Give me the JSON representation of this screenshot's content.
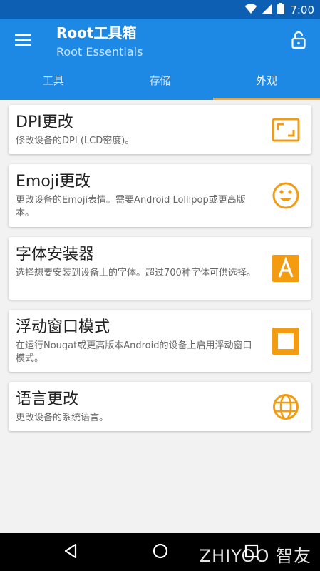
{
  "status_bar": {
    "time": "7:00"
  },
  "app_bar": {
    "title": "Root工具箱",
    "subtitle": "Root Essentials",
    "colors": {
      "primary": "#1e88e5",
      "status": "#0d5fb3",
      "accent": "#f5a623"
    }
  },
  "tabs": [
    {
      "label": "工具"
    },
    {
      "label": "存储"
    },
    {
      "label": "外观",
      "active": true
    }
  ],
  "cards": [
    {
      "title": "DPI更改",
      "desc": "修改设备的DPI (LCD密度)。",
      "icon": "aspect-ratio-icon"
    },
    {
      "title": "Emoji更改",
      "desc": "更改设备的Emoji表情。需要Android Lollipop或更高版本。",
      "icon": "smiley-icon"
    },
    {
      "title": "字体安装器",
      "desc": "选择想要安装到设备上的字体。超过700种字体可供选择。",
      "icon": "font-a-icon"
    },
    {
      "title": "浮动窗口模式",
      "desc": "在运行Nougat或更高版本Android的设备上启用浮动窗口模式。",
      "icon": "floating-window-icon"
    },
    {
      "title": "语言更改",
      "desc": "更改设备的系统语言。",
      "icon": "globe-icon"
    }
  ],
  "watermark": "ZHIYOO 智友"
}
